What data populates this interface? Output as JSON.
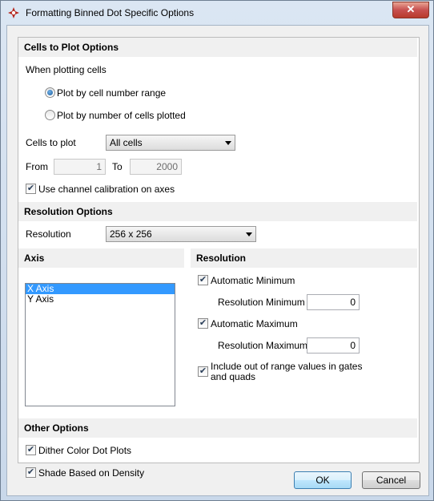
{
  "window": {
    "title": "Formatting Binned Dot Specific Options",
    "close_glyph": "✕"
  },
  "cells_section": {
    "header": "Cells to Plot Options",
    "when_label": "When plotting cells",
    "radio_range": "Plot by cell number range",
    "radio_count": "Plot by number of cells plotted",
    "cells_to_plot_label": "Cells to plot",
    "cells_to_plot_value": "All cells",
    "from_label": "From",
    "from_value": "1",
    "to_label": "To",
    "to_value": "2000",
    "channel_calibration_label": "Use channel calibration on axes",
    "channel_calibration_checked": true
  },
  "resolution_section": {
    "header": "Resolution Options",
    "resolution_label": "Resolution",
    "resolution_value": "256 x 256"
  },
  "axis_section": {
    "header": "Axis",
    "items": [
      "X Axis",
      "Y Axis"
    ],
    "selected": "X Axis"
  },
  "res_section": {
    "header": "Resolution",
    "auto_min_label": "Automatic Minimum",
    "res_min_label": "Resolution Minimum",
    "res_min_value": "0",
    "auto_max_label": "Automatic Maximum",
    "res_max_label": "Resolution Maximum",
    "res_max_value": "0",
    "include_label_line1": "Include out of range values in gates",
    "include_label_line2": "and quads"
  },
  "other_section": {
    "header": "Other Options",
    "dither_label": "Dither Color Dot Plots",
    "shade_label": "Shade Based on Density"
  },
  "buttons": {
    "ok": "OK",
    "cancel": "Cancel"
  },
  "icons": {
    "app": "app-logo-icon",
    "check": "checkmark-icon",
    "dropdown": "chevron-down-icon"
  },
  "colors": {
    "selection": "#3399ff",
    "section_header_bg": "#f0f0f0",
    "default_button_border": "#3c7fb1"
  }
}
